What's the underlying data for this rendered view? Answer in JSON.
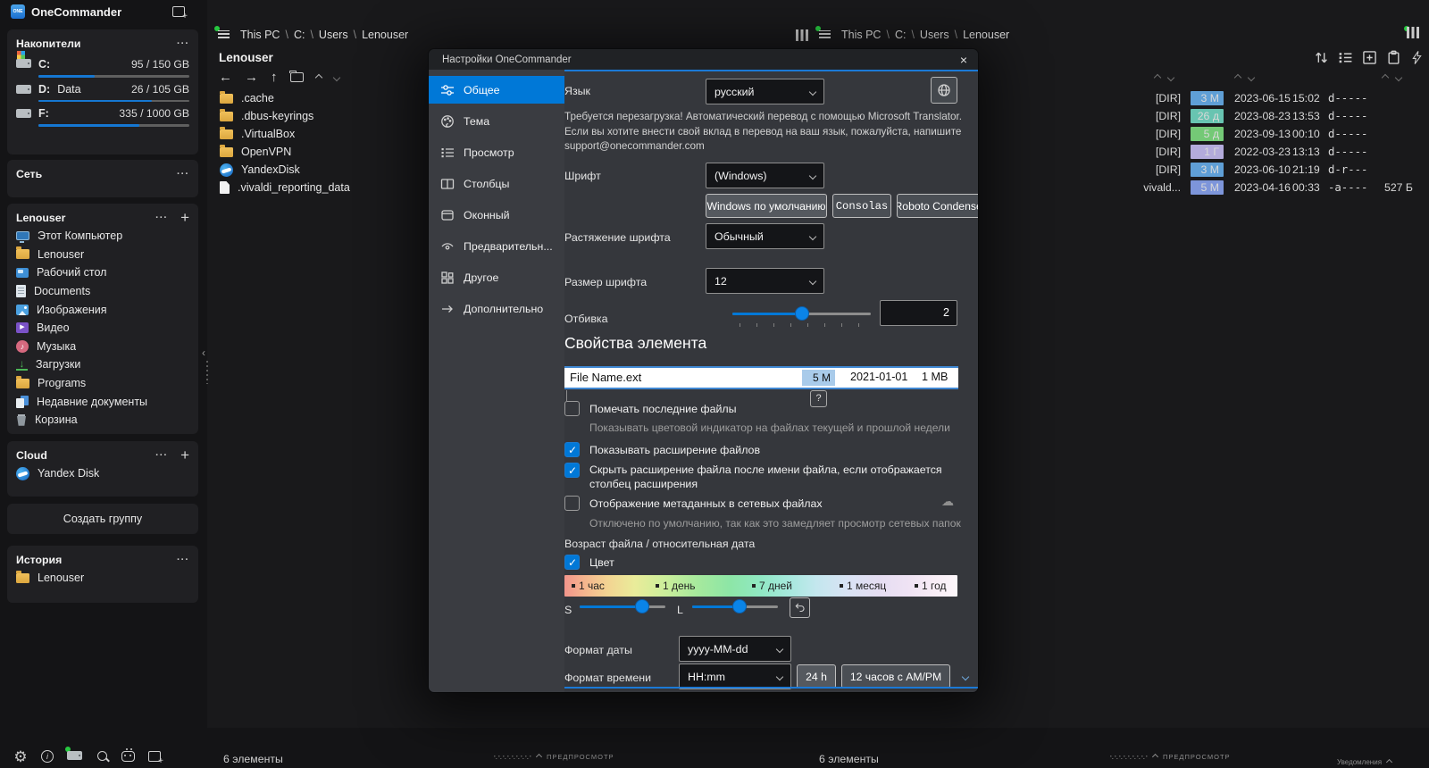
{
  "app": {
    "title": "OneCommander"
  },
  "sidebar": {
    "drives": {
      "title": "Накопители",
      "items": [
        {
          "letter": "C:",
          "name": "",
          "usage": "95 / 150 GB",
          "percent": "37%"
        },
        {
          "letter": "D:",
          "name": "Data",
          "usage": "26 / 105 GB",
          "percent": "75%"
        },
        {
          "letter": "F:",
          "name": "",
          "usage": "335 / 1000 GB",
          "percent": "67%"
        }
      ]
    },
    "network": {
      "title": "Сеть"
    },
    "user": {
      "title": "Lenouser",
      "items": [
        {
          "label": "Этот Компьютер"
        },
        {
          "label": "Lenouser"
        },
        {
          "label": "Рабочий стол"
        },
        {
          "label": "Documents"
        },
        {
          "label": "Изображения"
        },
        {
          "label": "Видео"
        },
        {
          "label": "Музыка"
        },
        {
          "label": "Загрузки"
        },
        {
          "label": "Programs"
        },
        {
          "label": "Недавние документы"
        },
        {
          "label": "Корзина"
        }
      ]
    },
    "cloud": {
      "title": "Cloud",
      "items": [
        {
          "label": "Yandex Disk"
        }
      ]
    },
    "create_group": "Создать группу",
    "history": {
      "title": "История",
      "items": [
        {
          "label": "Lenouser"
        }
      ]
    }
  },
  "left_pane": {
    "tab": "Lenouser",
    "breadcrumb": [
      "This PC",
      "C:",
      "Users",
      "Lenouser"
    ],
    "folder_title": "Lenouser",
    "files": [
      {
        "name": ".cache"
      },
      {
        "name": ".dbus-keyrings"
      },
      {
        "name": ".VirtualBox"
      },
      {
        "name": "OpenVPN"
      },
      {
        "name": "YandexDisk"
      },
      {
        "name": ".vivaldi_reporting_data"
      }
    ],
    "status": "6 элементы",
    "preview_label": "ПРЕДПРОСМОТР"
  },
  "right_pane": {
    "tab": "Lenouser",
    "breadcrumb": [
      "This PC",
      "C:",
      "Users",
      "Lenouser"
    ],
    "rows": [
      {
        "label": "[DIR]",
        "age": "3 M",
        "age_bg": "#5f9fd6",
        "date": "2023-06-15",
        "time": "15:02",
        "attrs": "d-----",
        "size": ""
      },
      {
        "label": "[DIR]",
        "age": "26 д",
        "age_bg": "#68c4b1",
        "date": "2023-08-23",
        "time": "13:53",
        "attrs": "d-----",
        "size": ""
      },
      {
        "label": "[DIR]",
        "age": "5 д",
        "age_bg": "#74c976",
        "date": "2023-09-13",
        "time": "00:10",
        "attrs": "d-----",
        "size": ""
      },
      {
        "label": "[DIR]",
        "age": "1 Г",
        "age_bg": "#b3abdb",
        "date": "2022-03-23",
        "time": "13:13",
        "attrs": "d-----",
        "size": ""
      },
      {
        "label": "[DIR]",
        "age": "3 M",
        "age_bg": "#5f9fd6",
        "date": "2023-06-10",
        "time": "21:19",
        "attrs": "d-r---",
        "size": ""
      },
      {
        "label": "vivald...",
        "age": "5 M",
        "age_bg": "#7d95da",
        "date": "2023-04-16",
        "time": "00:33",
        "attrs": "-a----",
        "size": "527 Б"
      }
    ],
    "status": "6 элементы",
    "preview_label": "ПРЕДПРОСМОТР",
    "notifications_label": "Уведомления"
  },
  "dialog": {
    "title": "Настройки OneCommander",
    "accent_color": "#0078d7",
    "tabs": [
      {
        "label": "Общее"
      },
      {
        "label": "Тема"
      },
      {
        "label": "Просмотр"
      },
      {
        "label": "Столбцы"
      },
      {
        "label": "Оконный"
      },
      {
        "label": "Предварительн..."
      },
      {
        "label": "Другое"
      },
      {
        "label": "Дополнительно"
      }
    ],
    "language": {
      "label": "Язык",
      "value": "русский"
    },
    "restart_note": "Требуется перезагрузка! Автоматический перевод с помощью Microsoft Translator. Если вы хотите внести свой вклад в перевод на ваш язык, пожалуйста, напишите support@onecommander.com",
    "font": {
      "label": "Шрифт",
      "value": "(Windows)",
      "presets": [
        "Windows по умолчанию",
        "Consolas",
        "Roboto Condensed"
      ]
    },
    "stretch": {
      "label": "Растяжение шрифта",
      "value": "Обычный"
    },
    "size": {
      "label": "Размер шрифта",
      "value": "12"
    },
    "spacing": {
      "label": "Отбивка",
      "value": "2"
    },
    "props": {
      "heading": "Свойства элемента",
      "sample": {
        "name": "File Name.ext",
        "age": "5 M",
        "date": "2021-01-01",
        "size": "1 MB"
      },
      "help": "?",
      "checks": [
        {
          "label": "Помечать последние файлы",
          "note": "Показывать цветовой индикатор на файлах текущей и прошлой недели"
        },
        {
          "label": "Показывать расширение файлов"
        },
        {
          "label": "Скрыть расширение файла после имени файла, если отображается столбец расширения"
        },
        {
          "label": "Отображение метаданных в сетевых файлах",
          "note": "Отключено по умолчанию, так как это замедляет просмотр сетевых папок"
        }
      ]
    },
    "age": {
      "label": "Возраст файла / относительная дата",
      "color_label": "Цвет",
      "scale": [
        "1 час",
        "1 день",
        "7 дней",
        "1 месяц",
        "1 год"
      ],
      "s_label": "S",
      "l_label": "L"
    },
    "date_format": {
      "label": "Формат даты",
      "value": "yyyy-MM-dd"
    },
    "time_format": {
      "label": "Формат времени",
      "value": "HH:mm",
      "buttons": [
        "24 h",
        "12 часов с AM/PM"
      ]
    }
  }
}
